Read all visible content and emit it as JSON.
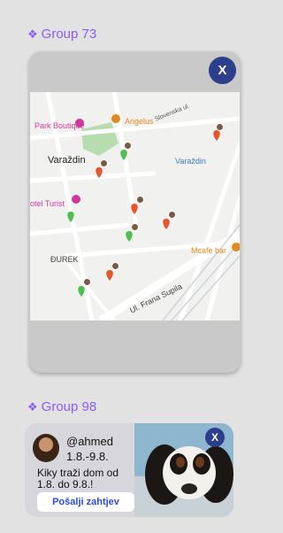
{
  "groups": [
    {
      "label": "Group 73",
      "icon": "diamond-group-icon"
    },
    {
      "label": "Group 98",
      "icon": "diamond-group-icon"
    }
  ],
  "close_label": "X",
  "map": {
    "labels": {
      "park": "Park Boutique",
      "angelus": "Angelus",
      "slovenska": "Slovenska ul.",
      "varazdin": "Varaždin",
      "varazdin_station": "Varaždin",
      "hotel": "otel Turist",
      "durek": "ĐUREK",
      "mcafe": "Mcafe bar",
      "frana": "Ul. Frana Supila"
    }
  },
  "card": {
    "username": "@ahmed",
    "dates": "1.8.-9.8.",
    "description": "Kiky traži dom od 1.8. do 9.8.!",
    "button": "Pošalji zahtjev"
  },
  "colors": {
    "accent": "#8a5cf5",
    "close": "#2c3f8c",
    "button_text": "#2f4bd0"
  }
}
